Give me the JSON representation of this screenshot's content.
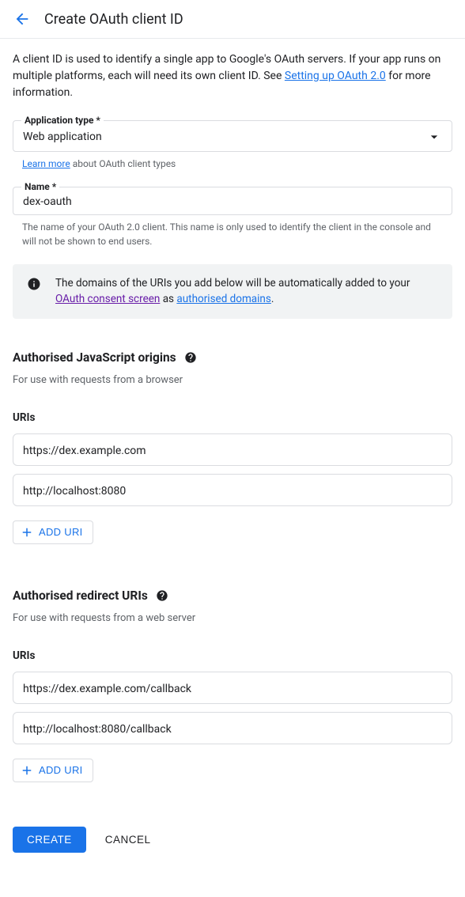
{
  "header": {
    "title": "Create OAuth client ID"
  },
  "intro": {
    "text_before": "A client ID is used to identify a single app to Google's OAuth servers. If your app runs on multiple platforms, each will need its own client ID. See ",
    "link": "Setting up OAuth 2.0",
    "text_after": " for more information."
  },
  "app_type_field": {
    "label": "Application type *",
    "value": "Web application",
    "helper_link": "Learn more",
    "helper_text": " about OAuth client types"
  },
  "name_field": {
    "label": "Name *",
    "value": "dex-oauth",
    "helper": "The name of your OAuth 2.0 client. This name is only used to identify the client in the console and will not be shown to end users."
  },
  "info_box": {
    "text_before": "The domains of the URIs you add below will be automatically added to your ",
    "link1": "OAuth consent screen",
    "mid": " as ",
    "link2": "authorised domains",
    "text_after": "."
  },
  "js_origins": {
    "heading": "Authorised JavaScript origins",
    "sub": "For use with requests from a browser",
    "uris_label": "URIs",
    "uris": [
      "https://dex.example.com",
      "http://localhost:8080"
    ],
    "add_label": "ADD URI"
  },
  "redirect_uris": {
    "heading": "Authorised redirect URIs",
    "sub": "For use with requests from a web server",
    "uris_label": "URIs",
    "uris": [
      "https://dex.example.com/callback",
      "http://localhost:8080/callback"
    ],
    "add_label": "ADD URI"
  },
  "buttons": {
    "create": "CREATE",
    "cancel": "CANCEL"
  }
}
